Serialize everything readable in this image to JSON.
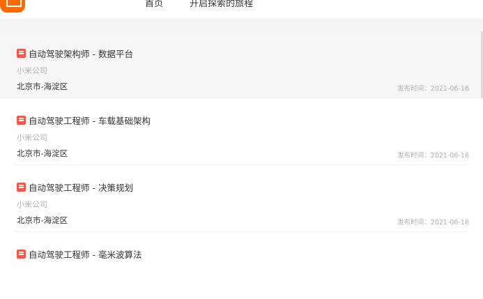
{
  "header": {
    "nav": [
      "首页",
      "开启探索的旅程"
    ]
  },
  "jobs": [
    {
      "title": "自动驾驶架构师 - 数据平台",
      "company": "小米公司",
      "location": "北京市-海淀区",
      "date": "发布时间：2021-06-16"
    },
    {
      "title": "自动驾驶工程师 - 车载基础架构",
      "company": "小米公司",
      "location": "北京市-海淀区",
      "date": "发布时间：2021-06-16"
    },
    {
      "title": "自动驾驶工程师 - 决策规划",
      "company": "小米公司",
      "location": "北京市-海淀区",
      "date": "发布时间：2021-06-16"
    },
    {
      "title": "自动驾驶工程师 - 毫米波算法",
      "company": "",
      "location": "",
      "date": ""
    }
  ],
  "colors": {
    "brand": "#ff6900",
    "badge": "#ef5b4d",
    "muted": "#b0b0b0"
  }
}
